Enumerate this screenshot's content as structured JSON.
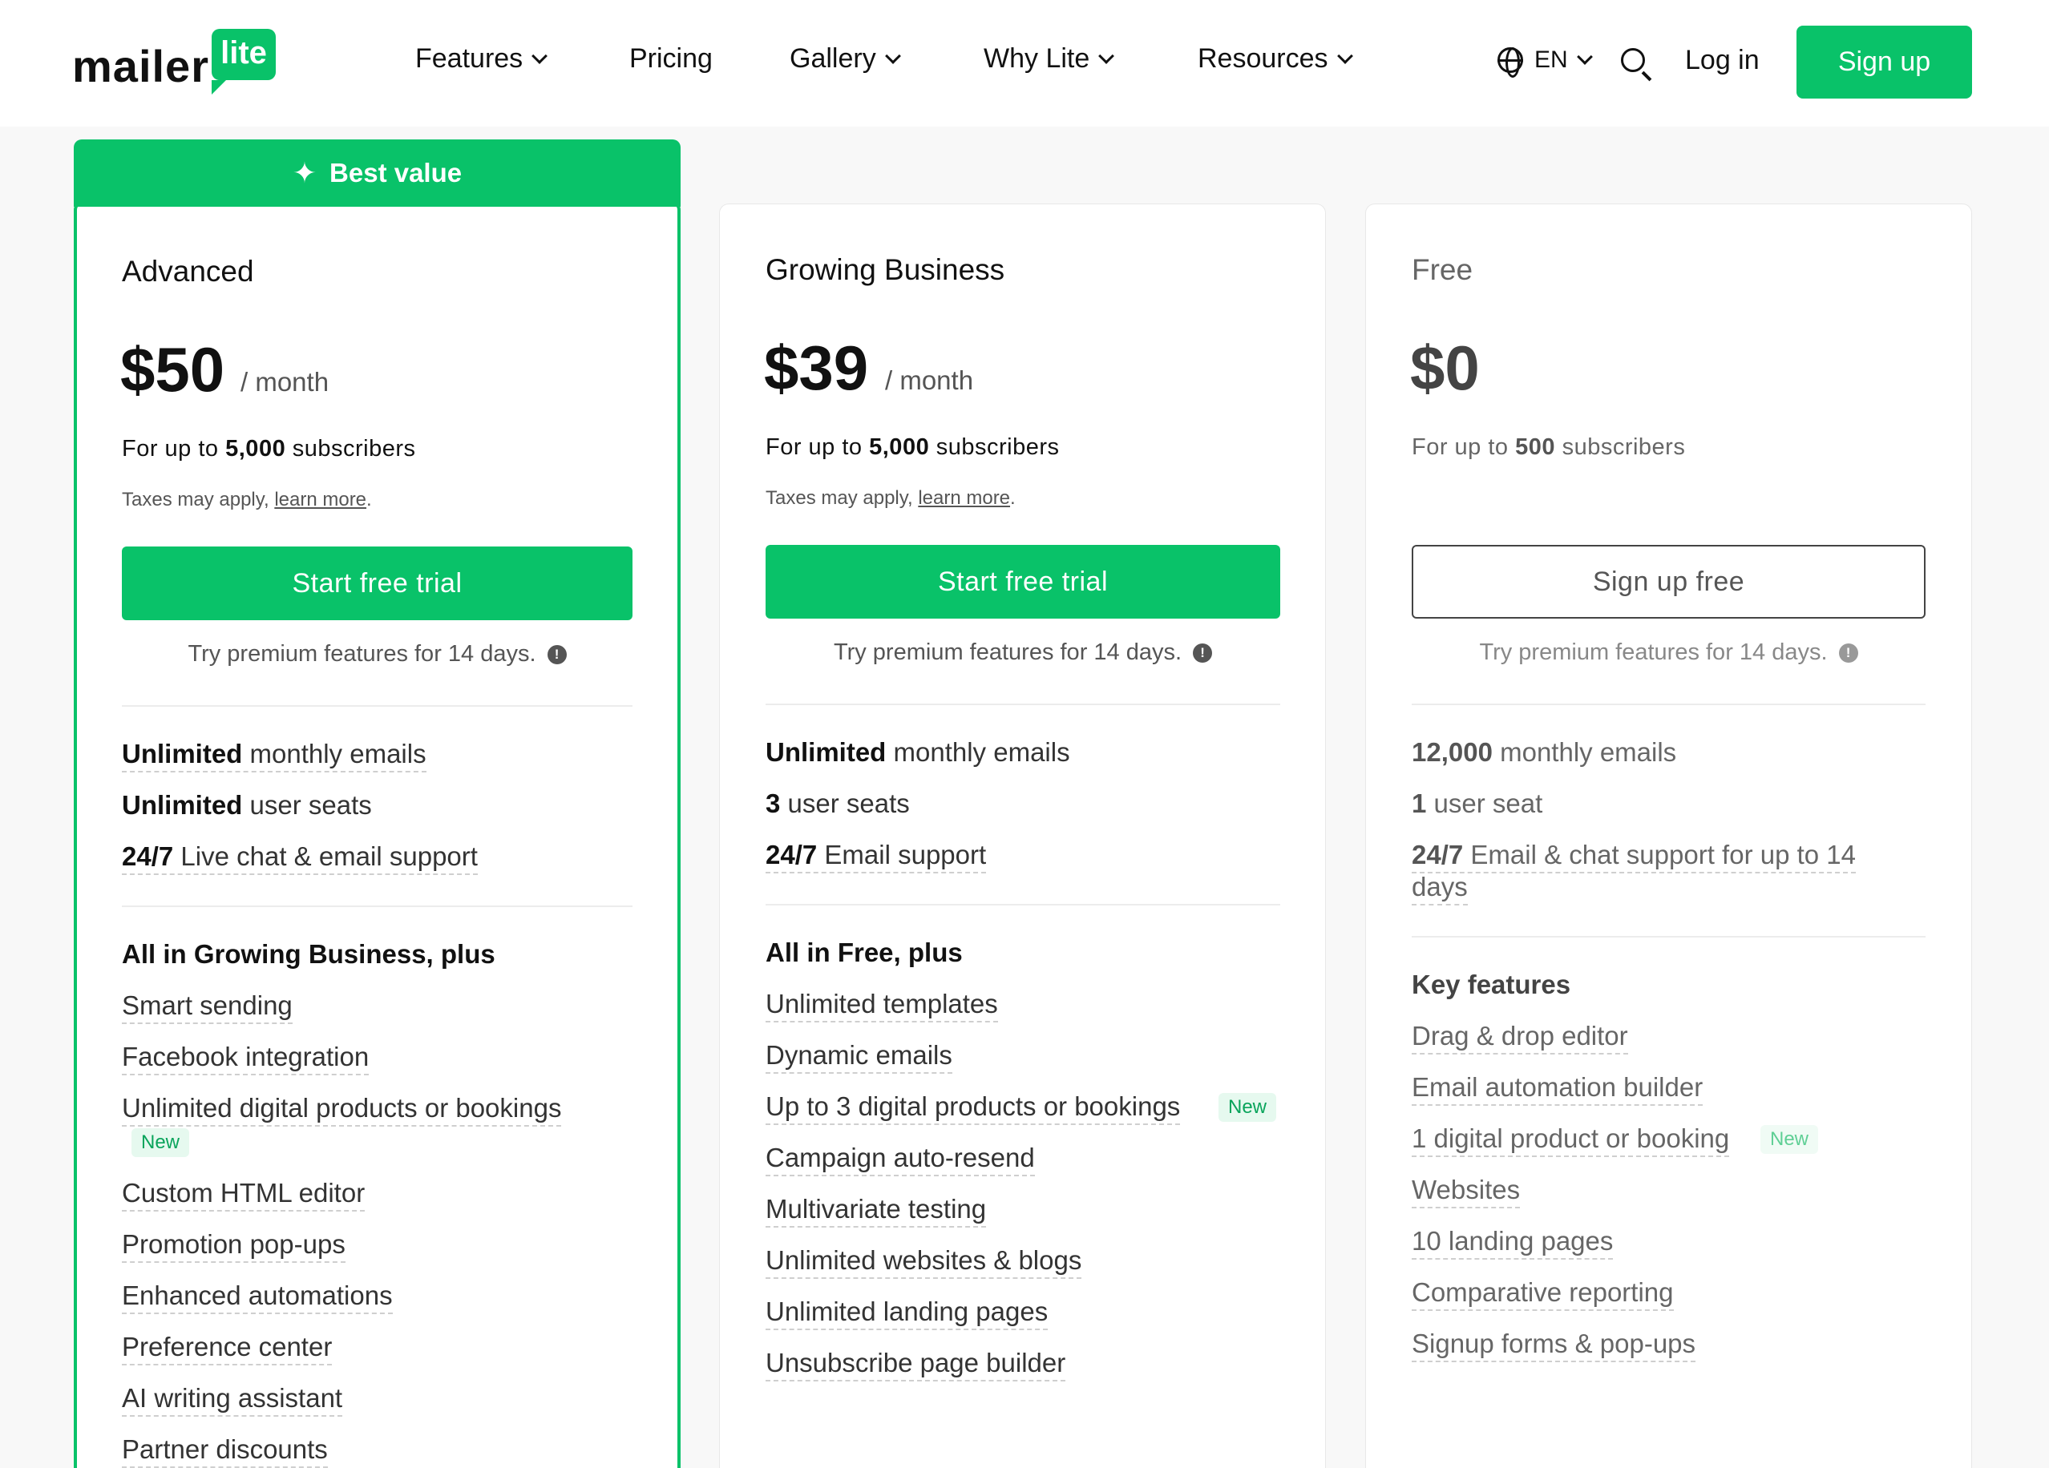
{
  "header": {
    "logo_text": "mailer",
    "logo_badge": "lite",
    "nav": [
      "Features",
      "Pricing",
      "Gallery",
      "Why Lite",
      "Resources"
    ],
    "lang": "EN",
    "login": "Log in",
    "signup": "Sign up"
  },
  "ribbon": "Best value",
  "plans": [
    {
      "name": "Advanced",
      "price": "$50",
      "per": "/ month",
      "subs_prefix": "For up to ",
      "subs_count": "5,000",
      "subs_suffix": " subscribers",
      "tax_text": "Taxes may apply, ",
      "tax_link": "learn more",
      "cta": "Start free trial",
      "try": "Try premium features for 14 days.",
      "limits": [
        {
          "bold": "Unlimited",
          "rest": " monthly emails"
        },
        {
          "bold": "Unlimited",
          "rest": " user seats"
        },
        {
          "bold": "24/7",
          "rest": " Live chat & email support"
        }
      ],
      "section": "All in Growing Business, plus",
      "features": [
        "Smart sending",
        "Facebook integration",
        "Unlimited digital products or bookings",
        "Custom HTML editor",
        "Promotion pop-ups",
        "Enhanced automations",
        "Preference center",
        "AI writing assistant",
        "Partner discounts"
      ],
      "badge": "New"
    },
    {
      "name": "Growing Business",
      "price": "$39",
      "per": "/ month",
      "subs_prefix": "For up to ",
      "subs_count": "5,000",
      "subs_suffix": " subscribers",
      "tax_text": "Taxes may apply, ",
      "tax_link": "learn more",
      "cta": "Start free trial",
      "try": "Try premium features for 14 days.",
      "limits": [
        {
          "bold": "Unlimited",
          "rest": " monthly emails"
        },
        {
          "bold": "3",
          "rest": " user seats"
        },
        {
          "bold": "24/7",
          "rest": " Email support"
        }
      ],
      "section": "All in Free, plus",
      "features": [
        "Unlimited templates",
        "Dynamic emails",
        "Up to 3 digital products or bookings",
        "Campaign auto-resend",
        "Multivariate testing",
        "Unlimited websites & blogs",
        "Unlimited landing pages",
        "Unsubscribe page builder"
      ],
      "badge": "New"
    },
    {
      "name": "Free",
      "price": "$0",
      "subs_prefix": "For up to ",
      "subs_count": "500",
      "subs_suffix": " subscribers",
      "cta": "Sign up free",
      "try": "Try premium features for 14 days.",
      "limits": [
        {
          "bold": "12,000",
          "rest": " monthly emails"
        },
        {
          "bold": "1",
          "rest": " user seat"
        },
        {
          "bold": "24/7",
          "rest": " Email & chat support for up to 14"
        },
        {
          "bold": "",
          "rest": "days"
        }
      ],
      "section": "Key features",
      "features": [
        "Drag & drop editor",
        "Email automation builder",
        "1 digital product or booking",
        "Websites",
        "10 landing pages",
        "Comparative reporting",
        "Signup forms & pop-ups"
      ],
      "badge": "New"
    }
  ],
  "colors": {
    "brand": "#09c269",
    "badge_bg": "#e6f9ef"
  }
}
